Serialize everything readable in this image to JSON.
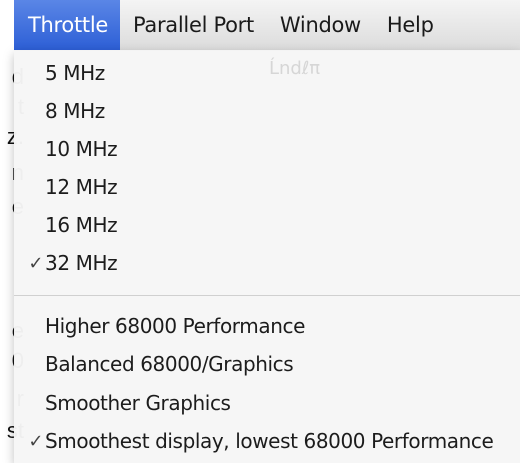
{
  "menubar": {
    "items": [
      {
        "label": "Throttle",
        "active": true
      },
      {
        "label": "Parallel Port",
        "active": false
      },
      {
        "label": "Window",
        "active": false
      },
      {
        "label": "Help",
        "active": false
      }
    ]
  },
  "background_fragments": [
    "d",
    "t",
    "z.",
    "n",
    "e",
    "e",
    "0",
    "r",
    "st"
  ],
  "ghost_label": "Ĺndℓπ",
  "throttle_menu": {
    "speed_items": [
      {
        "label": "5 MHz",
        "checked": false
      },
      {
        "label": "8 MHz",
        "checked": false
      },
      {
        "label": "10 MHz",
        "checked": false
      },
      {
        "label": "12 MHz",
        "checked": false
      },
      {
        "label": "16 MHz",
        "checked": false
      },
      {
        "label": "32 MHz",
        "checked": true
      }
    ],
    "mode_items": [
      {
        "label": "Higher 68000 Performance",
        "checked": false
      },
      {
        "label": "Balanced 68000/Graphics",
        "checked": false
      },
      {
        "label": "Smoother Graphics",
        "checked": false
      },
      {
        "label": "Smoothest display, lowest 68000 Performance",
        "checked": true
      }
    ],
    "check_glyph": "✓"
  },
  "colors": {
    "menubar_highlight": "#3a6ee0",
    "menu_background": "#f6f6f6"
  }
}
